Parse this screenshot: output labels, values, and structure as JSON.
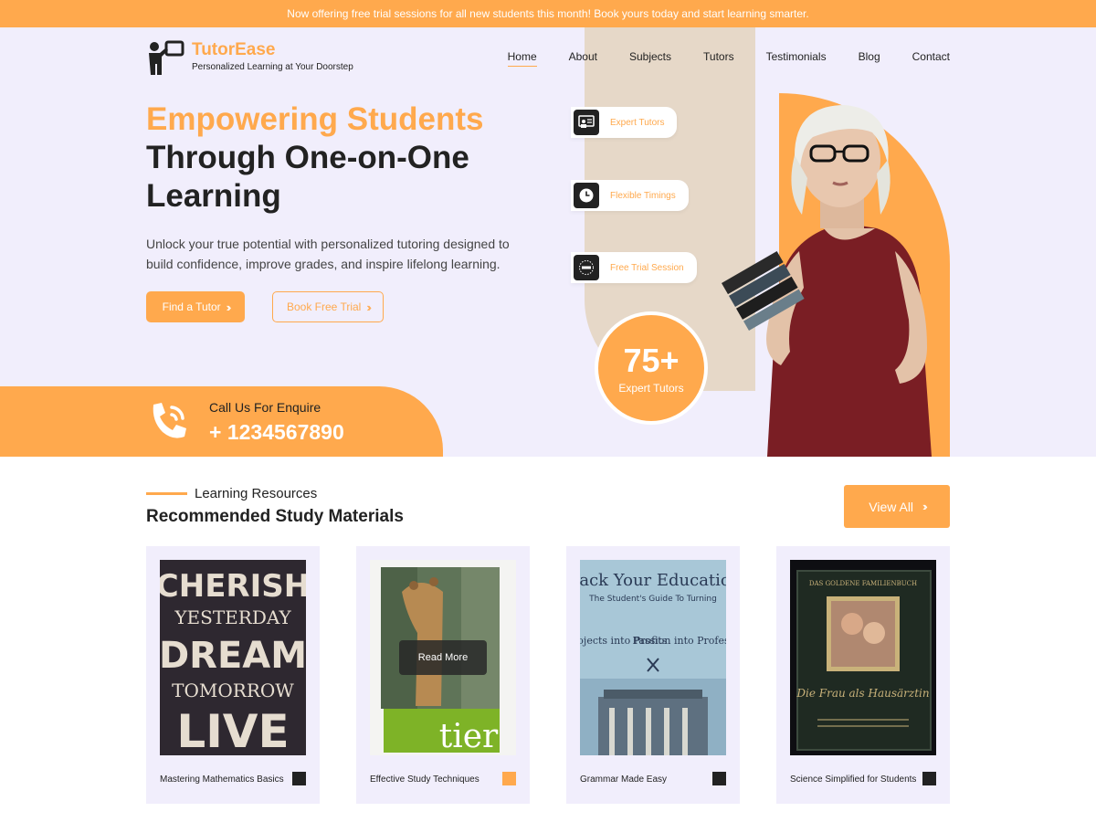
{
  "topbar": {
    "text": "Now offering free trial sessions for all new students this month! Book yours today and start learning smarter."
  },
  "brand": {
    "name": "TutorEase",
    "tagline": "Personalized Learning at Your Doorstep",
    "icon": "teacher-board-icon"
  },
  "nav": [
    {
      "label": "Home",
      "active": true
    },
    {
      "label": "About",
      "active": false
    },
    {
      "label": "Subjects",
      "active": false
    },
    {
      "label": "Tutors",
      "active": false
    },
    {
      "label": "Testimonials",
      "active": false
    },
    {
      "label": "Blog",
      "active": false
    },
    {
      "label": "Contact",
      "active": false
    }
  ],
  "hero": {
    "title_accent": "Empowering Students",
    "title_line2": "Through One-on-One",
    "title_line3": "Learning",
    "description": "Unlock your true potential with personalized tutoring designed to build confidence, improve grades, and inspire lifelong learning.",
    "primary_button": "Find a Tutor",
    "secondary_button": "Book Free Trial"
  },
  "features": [
    {
      "label": "Expert Tutors",
      "icon": "presentation-icon"
    },
    {
      "label": "Flexible Timings",
      "icon": "clock-icon"
    },
    {
      "label": "Free Trial Session",
      "icon": "free-badge-icon"
    }
  ],
  "stat": {
    "value": "75+",
    "label": "Expert Tutors"
  },
  "call": {
    "label": "Call Us For Enquire",
    "phone": "+ 1234567890",
    "icon": "phone-ring-icon"
  },
  "resources": {
    "eyebrow": "Learning Resources",
    "title": "Recommended Study Materials",
    "view_all": "View All",
    "read_more": "Read More",
    "cards": [
      {
        "title": "Mastering Mathematics Basics",
        "square_color": "#222222",
        "poster_lines": [
          "CHERISH",
          "YESTERDAY",
          "DREAM",
          "TOMORROW",
          "LIVE"
        ]
      },
      {
        "title": "Effective Study Techniques",
        "square_color": "#FFA94D",
        "poster_word": "tier"
      },
      {
        "title": "Grammar Made Easy",
        "square_color": "#222222",
        "book_title": "Hack Your Education",
        "book_subtitle": "The Student's Guide To Turning",
        "book_left": "Projects into Profits",
        "book_right": "Passion into Profession"
      },
      {
        "title": "Science Simplified for Students",
        "square_color": "#222222",
        "book_header": "DAS GOLDENE FAMILIENBUCH",
        "book_title": "Die Frau als Hausärztin"
      }
    ]
  },
  "colors": {
    "accent": "#FFA94D",
    "hero_bg": "#F1EEFC",
    "dark": "#222222"
  }
}
